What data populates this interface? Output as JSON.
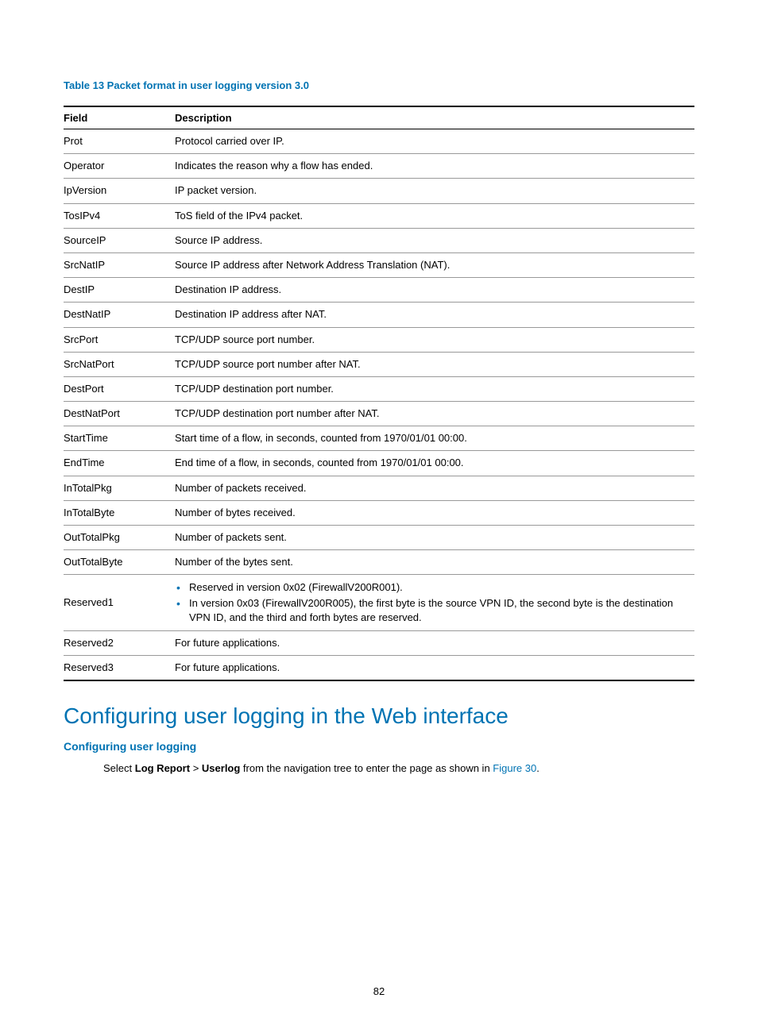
{
  "table": {
    "caption": "Table 13 Packet format in user logging version 3.0",
    "headers": {
      "field": "Field",
      "description": "Description"
    },
    "rows": [
      {
        "field": "Prot",
        "desc": "Protocol carried over IP."
      },
      {
        "field": "Operator",
        "desc": "Indicates the reason why a flow has ended."
      },
      {
        "field": "IpVersion",
        "desc": "IP packet version."
      },
      {
        "field": "TosIPv4",
        "desc": "ToS field of the IPv4 packet."
      },
      {
        "field": "SourceIP",
        "desc": "Source IP address."
      },
      {
        "field": "SrcNatIP",
        "desc": "Source IP address after Network Address Translation (NAT)."
      },
      {
        "field": "DestIP",
        "desc": "Destination IP address."
      },
      {
        "field": "DestNatIP",
        "desc": "Destination IP address after NAT."
      },
      {
        "field": "SrcPort",
        "desc": "TCP/UDP source port number."
      },
      {
        "field": "SrcNatPort",
        "desc": "TCP/UDP source port number after NAT."
      },
      {
        "field": "DestPort",
        "desc": "TCP/UDP destination port number."
      },
      {
        "field": "DestNatPort",
        "desc": "TCP/UDP destination port number after NAT."
      },
      {
        "field": "StartTime",
        "desc": "Start time of a flow, in seconds, counted from 1970/01/01 00:00."
      },
      {
        "field": "EndTime",
        "desc": "End time of a flow, in seconds, counted from 1970/01/01 00:00."
      },
      {
        "field": "InTotalPkg",
        "desc": "Number of packets received."
      },
      {
        "field": "InTotalByte",
        "desc": "Number of bytes received."
      },
      {
        "field": "OutTotalPkg",
        "desc": "Number of packets sent."
      },
      {
        "field": "OutTotalByte",
        "desc": "Number of the bytes sent."
      },
      {
        "field": "Reserved1",
        "bullets": [
          "Reserved in version 0x02 (FirewallV200R001).",
          "In version 0x03 (FirewallV200R005), the first byte is the source VPN ID, the second byte is the destination VPN ID, and the third and forth bytes are reserved."
        ]
      },
      {
        "field": "Reserved2",
        "desc": "For future applications."
      },
      {
        "field": "Reserved3",
        "desc": "For future applications."
      }
    ]
  },
  "headings": {
    "h1": "Configuring user logging in the Web interface",
    "h2": "Configuring user logging"
  },
  "paragraph": {
    "pre": "Select ",
    "b1": "Log Report",
    "gt": " > ",
    "b2": "Userlog",
    "mid": " from the navigation tree to enter the page as shown in ",
    "link": "Figure 30",
    "post": "."
  },
  "page_number": "82"
}
